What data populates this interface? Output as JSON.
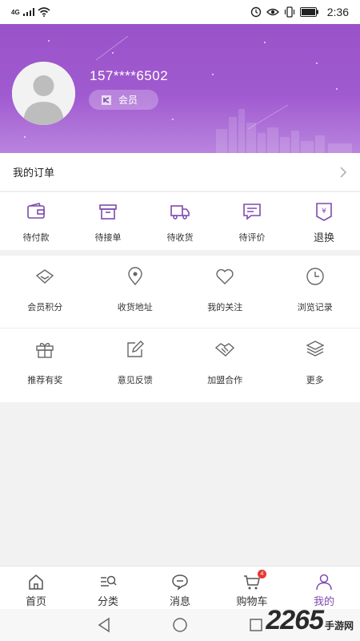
{
  "status_bar": {
    "signal": "4G",
    "time": "2:36"
  },
  "profile": {
    "phone": "157****6502",
    "member_label": "会员"
  },
  "orders": {
    "title": "我的订单",
    "items": [
      {
        "label": "待付款",
        "icon": "wallet-icon"
      },
      {
        "label": "待接单",
        "icon": "box-icon"
      },
      {
        "label": "待收货",
        "icon": "truck-icon"
      },
      {
        "label": "待评价",
        "icon": "comment-icon"
      },
      {
        "label": "退换",
        "icon": "refund-icon"
      }
    ]
  },
  "services": {
    "row1": [
      {
        "label": "会员积分",
        "icon": "diamond-icon"
      },
      {
        "label": "收货地址",
        "icon": "location-icon"
      },
      {
        "label": "我的关注",
        "icon": "heart-icon"
      },
      {
        "label": "浏览记录",
        "icon": "clock-icon"
      }
    ],
    "row2": [
      {
        "label": "推荐有奖",
        "icon": "gift-icon"
      },
      {
        "label": "意见反馈",
        "icon": "edit-icon"
      },
      {
        "label": "加盟合作",
        "icon": "handshake-icon"
      },
      {
        "label": "更多",
        "icon": "layers-icon"
      }
    ]
  },
  "tabbar": {
    "items": [
      {
        "label": "首页",
        "icon": "home-icon"
      },
      {
        "label": "分类",
        "icon": "category-icon"
      },
      {
        "label": "消息",
        "icon": "message-icon"
      },
      {
        "label": "购物车",
        "icon": "cart-icon",
        "badge": "4"
      },
      {
        "label": "我的",
        "icon": "user-icon",
        "active": true
      }
    ]
  },
  "watermark": {
    "number": "2265",
    "suffix": "手游网"
  },
  "colors": {
    "accent": "#7e4ab1",
    "header_top": "#9a52c9",
    "badge": "#e53935"
  }
}
